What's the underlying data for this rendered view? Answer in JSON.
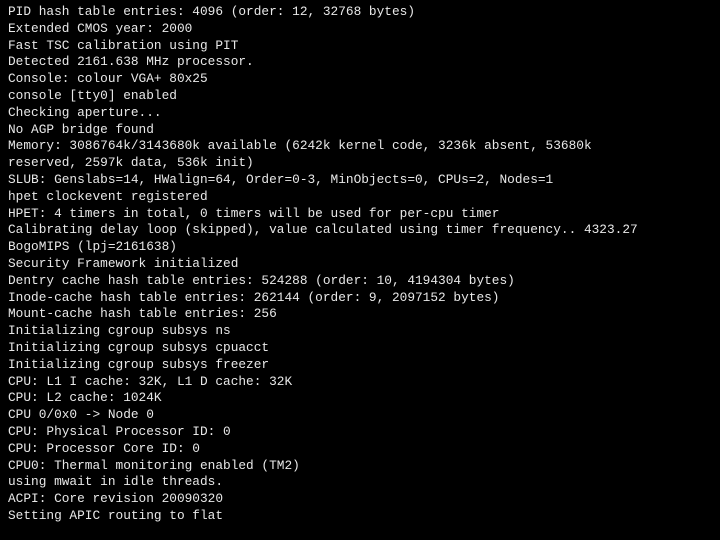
{
  "console": {
    "background": "#000000",
    "foreground": "#e8e8e8",
    "lines": [
      "PID hash table entries: 4096 (order: 12, 32768 bytes)",
      "Extended CMOS year: 2000",
      "Fast TSC calibration using PIT",
      "Detected 2161.638 MHz processor.",
      "Console: colour VGA+ 80x25",
      "console [tty0] enabled",
      "Checking aperture...",
      "No AGP bridge found",
      "Memory: 3086764k/3143680k available (6242k kernel code, 3236k absent, 53680k",
      "reserved, 2597k data, 536k init)",
      "SLUB: Genslabs=14, HWalign=64, Order=0-3, MinObjects=0, CPUs=2, Nodes=1",
      "hpet clockevent registered",
      "HPET: 4 timers in total, 0 timers will be used for per-cpu timer",
      "Calibrating delay loop (skipped), value calculated using timer frequency.. 4323.27",
      "BogoMIPS (lpj=2161638)",
      "Security Framework initialized",
      "Dentry cache hash table entries: 524288 (order: 10, 4194304 bytes)",
      "Inode-cache hash table entries: 262144 (order: 9, 2097152 bytes)",
      "Mount-cache hash table entries: 256",
      "Initializing cgroup subsys ns",
      "Initializing cgroup subsys cpuacct",
      "Initializing cgroup subsys freezer",
      "CPU: L1 I cache: 32K, L1 D cache: 32K",
      "CPU: L2 cache: 1024K",
      "CPU 0/0x0 -> Node 0",
      "CPU: Physical Processor ID: 0",
      "CPU: Processor Core ID: 0",
      "CPU0: Thermal monitoring enabled (TM2)",
      "using mwait in idle threads.",
      "ACPI: Core revision 20090320",
      "Setting APIC routing to flat"
    ]
  }
}
